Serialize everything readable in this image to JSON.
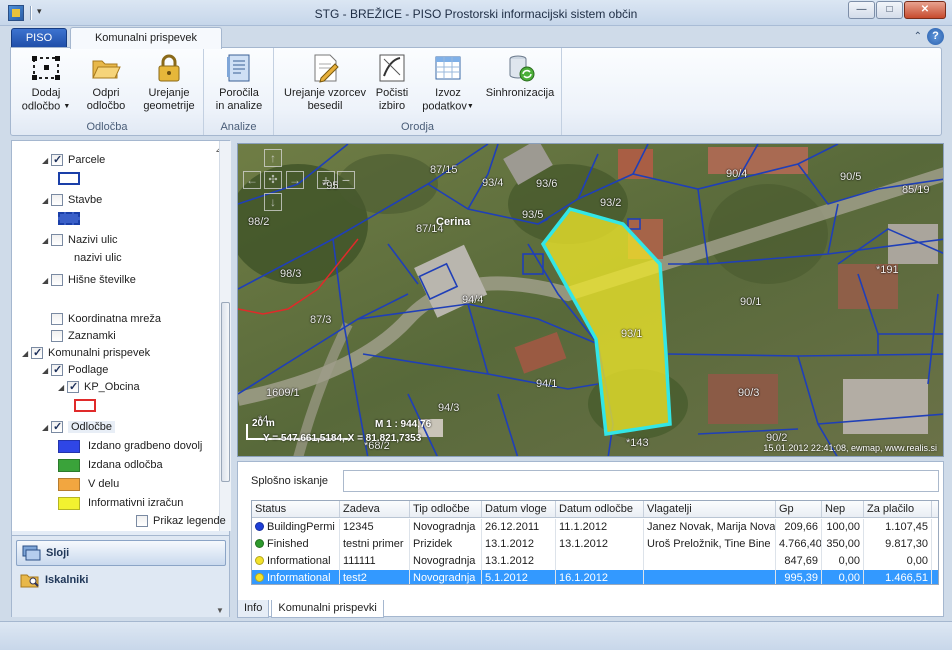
{
  "window": {
    "title": "STG - BREŽICE - PISO Prostorski informacijski sistem občin",
    "buttons": {
      "minimize": "—",
      "maximize": "□",
      "close": "✕"
    }
  },
  "ribbon": {
    "file_tab": "PISO",
    "active_tab": "Komunalni prispevek",
    "groups": [
      {
        "label": "Odločba",
        "buttons": [
          {
            "label1": "Dodaj",
            "label2": "odločbo",
            "dropdown": true,
            "icon": "add-decision-icon"
          },
          {
            "label1": "Odpri",
            "label2": "odločbo",
            "dropdown": false,
            "icon": "folder-open-icon"
          },
          {
            "label1": "Urejanje",
            "label2": "geometrije",
            "dropdown": false,
            "icon": "lock-icon"
          }
        ]
      },
      {
        "label": "Analize",
        "buttons": [
          {
            "label1": "Poročila",
            "label2": "in analize",
            "dropdown": false,
            "icon": "report-icon"
          }
        ]
      },
      {
        "label": "Orodja",
        "buttons": [
          {
            "label1": "Urejanje vzorcev",
            "label2": "besedil",
            "dropdown": false,
            "icon": "edit-template-icon"
          },
          {
            "label1": "Počisti",
            "label2": "izbiro",
            "dropdown": false,
            "icon": "clear-selection-icon"
          },
          {
            "label1": "Izvoz",
            "label2": "podatkov",
            "dropdown": true,
            "icon": "export-icon"
          },
          {
            "label1": "Sinhronizacija",
            "label2": "",
            "dropdown": false,
            "icon": "sync-icon"
          }
        ]
      }
    ]
  },
  "layers": {
    "items": [
      {
        "label": "Parcele",
        "checked": true,
        "indent": 1,
        "expander": true
      },
      {
        "swatch": "parcele",
        "indent": 2
      },
      {
        "label": "Stavbe",
        "checked": false,
        "indent": 1,
        "expander": true
      },
      {
        "swatch": "stavbe",
        "indent": 2
      },
      {
        "label": "Nazivi ulic",
        "checked": false,
        "indent": 1,
        "expander": true
      },
      {
        "label": "nazivi ulic",
        "indent": 3
      },
      {
        "label": "Hišne številke",
        "checked": false,
        "indent": 1,
        "expander": true
      },
      {
        "label": "Koordinatna mreža",
        "checked": false,
        "indent": 1,
        "expander": false
      },
      {
        "label": "Zaznamki",
        "checked": false,
        "indent": 1,
        "expander": false
      },
      {
        "label": "Komunalni prispevek",
        "checked": true,
        "indent": 0,
        "expander": true
      },
      {
        "label": "Podlage",
        "checked": true,
        "indent": 1,
        "expander": true
      },
      {
        "label": "KP_Obcina",
        "checked": true,
        "indent": 2,
        "expander": true
      },
      {
        "swatch": "kp",
        "indent": 3
      },
      {
        "label": "Odločbe",
        "checked": true,
        "indent": 1,
        "expander": true
      },
      {
        "label": "Izdano gradbeno dovolj",
        "legend": "#2f46e6",
        "indent": 2
      },
      {
        "label": "Izdana odločba",
        "legend": "#3aa33a",
        "indent": 2
      },
      {
        "label": "V delu",
        "legend": "#f2a640",
        "indent": 2
      },
      {
        "label": "Informativni izračun",
        "legend": "#f2f230",
        "indent": 2
      }
    ],
    "legend_toggle": "Prikaz legende"
  },
  "nav": {
    "layers": "Sloji",
    "search": "Iskalniki"
  },
  "map": {
    "scale": "M 1 : 944,76",
    "coords": "Y = 547.661,5184, X = 81.821,7353",
    "scalebar": "20 m",
    "timestamp": "15.01.2012 22:41:08, ewmap, www.realis.si",
    "place_name": "Cerina",
    "parcel_labels": [
      "87/15",
      "93/4",
      "93/6",
      "93/2",
      "90/4",
      "90/5",
      "85/19",
      "98/2",
      "93/5",
      "87/14",
      "98/3",
      "94/4",
      "*191",
      "90/1",
      "87/3",
      "93/1",
      "94/1",
      "1609/1",
      "94/3",
      "90/3",
      "90/2",
      "*143",
      "*95",
      "*4",
      "*68/2"
    ]
  },
  "search": {
    "label": "Splošno iskanje",
    "value": "",
    "placeholder": ""
  },
  "table": {
    "columns": [
      "Status",
      "Zadeva",
      "Tip odločbe",
      "Datum vloge",
      "Datum odločbe",
      "Vlagatelji",
      "Gp",
      "Nep",
      "Za plačilo"
    ],
    "rows": [
      {
        "dot": "#1e3fd8",
        "status": "BuildingPermi",
        "zadeva": "12345",
        "tip": "Novogradnja",
        "vloga": "26.12.2011",
        "odlocba": "11.1.2012",
        "vlagatelji": "Janez Novak, Marija Nova",
        "gp": "209,66",
        "nep": "100,00",
        "placilo": "1.107,45",
        "selected": false
      },
      {
        "dot": "#2e9a2e",
        "status": "Finished",
        "zadeva": "testni primer",
        "tip": "Prizidek",
        "vloga": "13.1.2012",
        "odlocba": "13.1.2012",
        "vlagatelji": "Uroš Preložnik, Tine Bine",
        "gp": "4.766,40",
        "nep": "350,00",
        "placilo": "9.817,30",
        "selected": false
      },
      {
        "dot": "#f2e12a",
        "status": "Informational",
        "zadeva": "111111",
        "tip": "Novogradnja",
        "vloga": "13.1.2012",
        "odlocba": "",
        "vlagatelji": "",
        "gp": "847,69",
        "nep": "0,00",
        "placilo": "0,00",
        "selected": false
      },
      {
        "dot": "#f2e12a",
        "status": "Informational",
        "zadeva": "test2",
        "tip": "Novogradnja",
        "vloga": "5.1.2012",
        "odlocba": "16.1.2012",
        "vlagatelji": "",
        "gp": "995,39",
        "nep": "0,00",
        "placilo": "1.466,51",
        "selected": true
      }
    ]
  },
  "bottom_tabs": [
    "Info",
    "Komunalni prispevki"
  ]
}
